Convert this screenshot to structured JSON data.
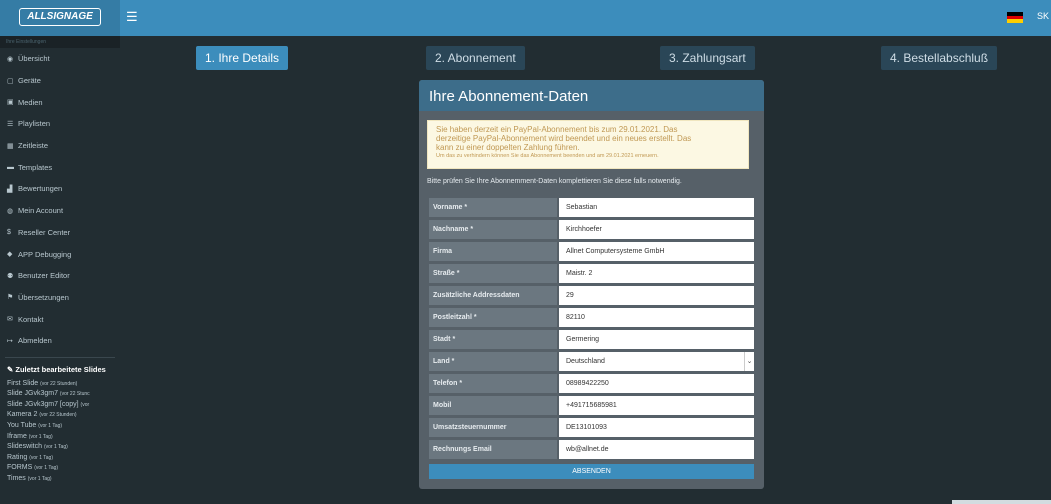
{
  "header": {
    "logo_text": "ALLSIGNAGE",
    "menu_icon": "hamburger-icon",
    "flag_colors": [
      "#000000",
      "#dd0000",
      "#ffce00"
    ],
    "user_initials": "SK €"
  },
  "sidebar": {
    "section_label": "Ihre Einstellungen",
    "items": [
      {
        "label": "Übersicht",
        "icon": "dashboard-icon",
        "glyph": "◉"
      },
      {
        "label": "Geräte",
        "icon": "device-icon",
        "glyph": "▢"
      },
      {
        "label": "Medien",
        "icon": "image-icon",
        "glyph": "▣"
      },
      {
        "label": "Playlisten",
        "icon": "list-icon",
        "glyph": "☰"
      },
      {
        "label": "Zeitleiste",
        "icon": "calendar-icon",
        "glyph": "▦"
      },
      {
        "label": "Templates",
        "icon": "folder-icon",
        "glyph": "▬"
      },
      {
        "label": "Bewertungen",
        "icon": "chart-icon",
        "glyph": "▟"
      },
      {
        "label": "Mein Account",
        "icon": "user-circle-icon",
        "glyph": "◍"
      },
      {
        "label": "Reseller Center",
        "icon": "dollar-icon",
        "glyph": "$"
      },
      {
        "label": "APP Debugging",
        "icon": "bug-icon",
        "glyph": "◆"
      },
      {
        "label": "Benutzer Editor",
        "icon": "users-icon",
        "glyph": "⚉"
      },
      {
        "label": "Übersetzungen",
        "icon": "flag-icon",
        "glyph": "⚑"
      },
      {
        "label": "Kontakt",
        "icon": "envelope-icon",
        "glyph": "✉"
      },
      {
        "label": "Abmelden",
        "icon": "sign-out-icon",
        "glyph": "↦"
      }
    ],
    "recent": {
      "title_icon": "edit-icon",
      "title": "Zuletzt bearbeitete Slides",
      "items": [
        {
          "name": "First Slide",
          "time": "(vor 22 Stunden)"
        },
        {
          "name": "Slide JGvk3gm7",
          "time": "(vor 22 Stunc"
        },
        {
          "name": "Slide JGvk3gm7 [copy]",
          "time": "(vor"
        },
        {
          "name": "Kamera 2",
          "time": "(vor 22 Stunden)"
        },
        {
          "name": "You Tube",
          "time": "(vor 1 Tag)"
        },
        {
          "name": "Iframe",
          "time": "(vor 1 Tag)"
        },
        {
          "name": "Slideswitch",
          "time": "(vor 1 Tag)"
        },
        {
          "name": "Rating",
          "time": "(vor 1 Tag)"
        },
        {
          "name": "FORMS",
          "time": "(vor 1 Tag)"
        },
        {
          "name": "Times",
          "time": "(vor 1 Tag)"
        }
      ]
    }
  },
  "steps": [
    {
      "label": "1. Ihre Details",
      "active": true
    },
    {
      "label": "2. Abonnement",
      "active": false
    },
    {
      "label": "3. Zahlungsart",
      "active": false
    },
    {
      "label": "4. Bestellabschluß",
      "active": false
    }
  ],
  "card": {
    "title": "Ihre Abonnement-Daten",
    "notice": {
      "line1": "Sie haben derzeit ein PayPal-Abonnement bis zum 29.01.2021. Das",
      "line2": "derzeitige PayPal-Abonnement wird beendet und ein neues erstellt. Das",
      "line3": "kann zu einer doppelten Zahlung führen.",
      "small": "Um das zu verhindern können Sie das Abonnement beenden und am 29.01.2021 erneuern."
    },
    "intro": "Bitte prüfen Sie Ihre Abonnemment-Daten komplettieren Sie diese falls notwendig.",
    "fields": [
      {
        "label": "Vorname *",
        "value": "Sebastian"
      },
      {
        "label": "Nachname *",
        "value": "Kirchhoefer"
      },
      {
        "label": "Firma",
        "value": "Allnet Computersysteme GmbH"
      },
      {
        "label": "Straße *",
        "value": "Maistr. 2"
      },
      {
        "label": "Zusätzliche Addressdaten",
        "value": "29"
      },
      {
        "label": "Postleitzahl *",
        "value": "82110"
      },
      {
        "label": "Stadt *",
        "value": "Germering"
      },
      {
        "label": "Land *",
        "value": "Deutschland",
        "type": "select"
      },
      {
        "label": "Telefon *",
        "value": "08989422250"
      },
      {
        "label": "Mobil",
        "value": "+491715685981"
      },
      {
        "label": "Umsatzsteuernummer",
        "value": "DE13101093"
      },
      {
        "label": "Rechnungs Email",
        "value": "wb@allnet.de"
      }
    ],
    "submit_label": "ABSENDEN"
  }
}
